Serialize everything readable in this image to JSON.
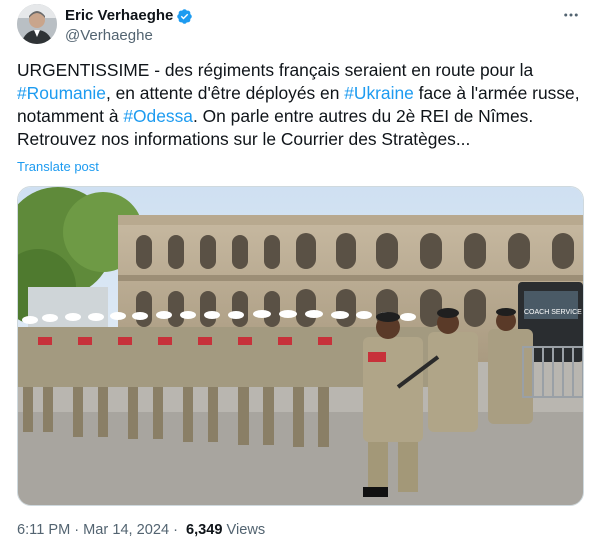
{
  "author": {
    "display_name": "Eric Verhaeghe",
    "handle": "@Verhaeghe",
    "verified_icon": "verified-badge-icon",
    "verified_color": "#1d9bf0"
  },
  "tweet": {
    "segments": [
      {
        "text": "URGENTISSIME - des régiments français seraient en route pour la ",
        "hashtag": false
      },
      {
        "text": "#Roumanie",
        "hashtag": true
      },
      {
        "text": ", en attente d'être déployés en ",
        "hashtag": false
      },
      {
        "text": "#Ukraine",
        "hashtag": true
      },
      {
        "text": " face à l'armée russe, notamment à ",
        "hashtag": false
      },
      {
        "text": "#Odessa",
        "hashtag": true
      },
      {
        "text": ". On parle entre autres du 2è REI de Nîmes. Retrouvez nos informations sur le Courrier des Stratèges...",
        "hashtag": false
      }
    ],
    "translate_label": "Translate post",
    "media_sign_text": "COACH SERVICE"
  },
  "meta": {
    "time": "6:11 PM",
    "separator": "·",
    "date": "Mar 14, 2024",
    "views_count": "6,349",
    "views_label": "Views"
  },
  "colors": {
    "link": "#1d9bf0",
    "secondary_text": "#536471",
    "primary_text": "#0f1419"
  }
}
